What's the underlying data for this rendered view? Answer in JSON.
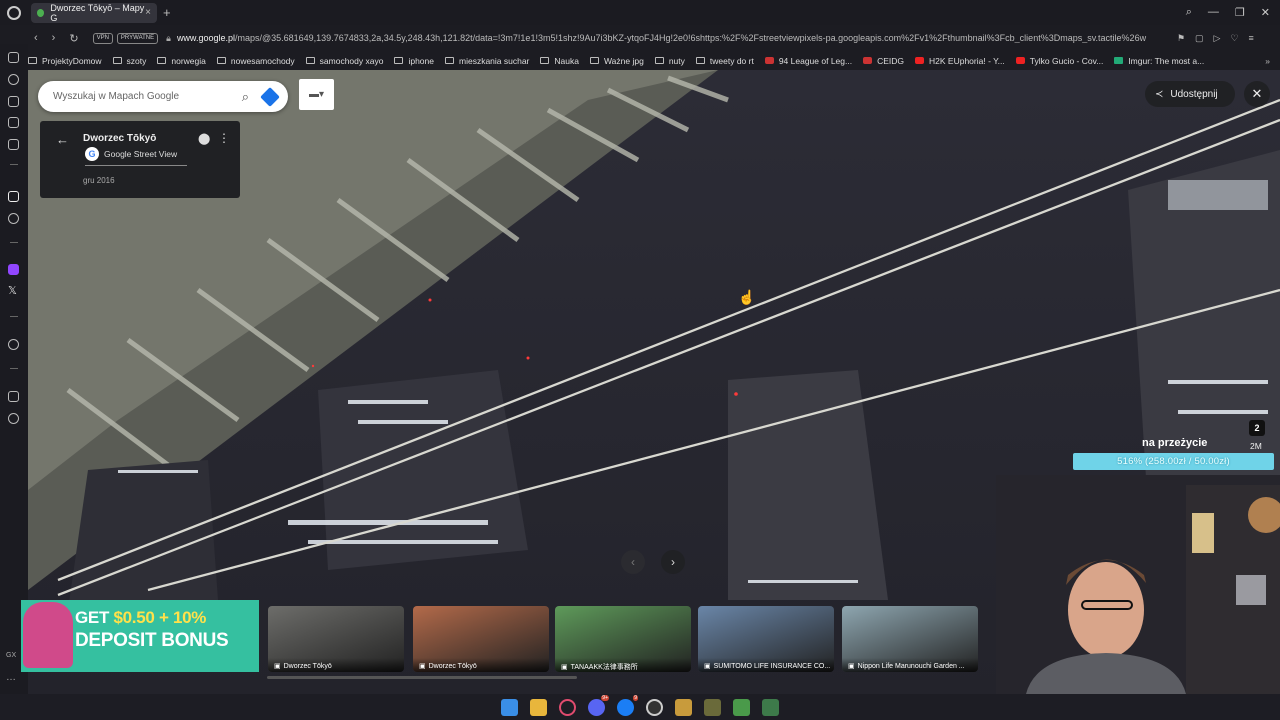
{
  "browser": {
    "tab_title": "Dworzec Tōkyō – Mapy G",
    "url_prefix": "www.google.pl",
    "url_rest": "/maps/@35.681649,139.7674833,2a,34.5y,248.43h,121.82t/data=!3m7!1e1!3m5!1shz!9Au7i3bKZ-ytqoFJ4Hg!2e0!6shttps:%2F%2Fstreetviewpixels-pa.googleapis.com%2Fv1%2Fthumbnail%3Fcb_client%3Dmaps_sv.tactile%26w",
    "vpn_label": "VPN",
    "private_label": "PRYWATNE"
  },
  "bookmarks": [
    {
      "label": "ProjektyDomow",
      "icon": "folder-icon"
    },
    {
      "label": "szoty",
      "icon": "folder-icon"
    },
    {
      "label": "norwegia",
      "icon": "folder-icon"
    },
    {
      "label": "nowesamochody",
      "icon": "folder-icon"
    },
    {
      "label": "samochody xayo",
      "icon": "folder-icon"
    },
    {
      "label": "iphone",
      "icon": "folder-icon"
    },
    {
      "label": "mieszkania suchar",
      "icon": "folder-icon"
    },
    {
      "label": "Nauka",
      "icon": "folder-icon"
    },
    {
      "label": "Ważne jpg",
      "icon": "folder-icon"
    },
    {
      "label": "nuty",
      "icon": "folder-icon"
    },
    {
      "label": "tweety do rt",
      "icon": "folder-icon"
    },
    {
      "label": "94 League of Leg...",
      "icon": "league-icon"
    },
    {
      "label": "CEIDG",
      "icon": "ceidg-icon"
    },
    {
      "label": "H2K EUphoria! - Y...",
      "icon": "youtube-icon"
    },
    {
      "label": "Tylko Gucio - Cov...",
      "icon": "youtube-icon"
    },
    {
      "label": "Imgur: The most a...",
      "icon": "imgur-icon"
    }
  ],
  "maps": {
    "search_placeholder": "Wyszukaj w Mapach Google",
    "place_title": "Dworzec Tōkyō",
    "source_label": "Google Street View",
    "date": "gru 2016",
    "share_label": "Udostępnij"
  },
  "stream": {
    "counter": "2",
    "counter_sub": "2M",
    "goal_title": "na przeżycie",
    "goal_text": "516% (258.00zł / 50.00zł)",
    "goal_progress_percent": 516
  },
  "ad": {
    "line1_a": "GET",
    "line1_b": "$0.50 + 10%",
    "line2": "DEPOSIT BONUS"
  },
  "photo_strip": [
    {
      "caption": "Dworzec Tōkyō",
      "color": "#6d6d6a"
    },
    {
      "caption": "Dworzec Tōkyō",
      "color": "#b36a4a"
    },
    {
      "caption": "TANAAKK法律事務所",
      "color": "#5e9a5a"
    },
    {
      "caption": "SUMITOMO LIFE INSURANCE CO...",
      "color": "#6a86a8"
    },
    {
      "caption": "Nippon Life Marunouchi Garden ...",
      "color": "#8ea6b0"
    }
  ],
  "sidebar_label": "GX"
}
